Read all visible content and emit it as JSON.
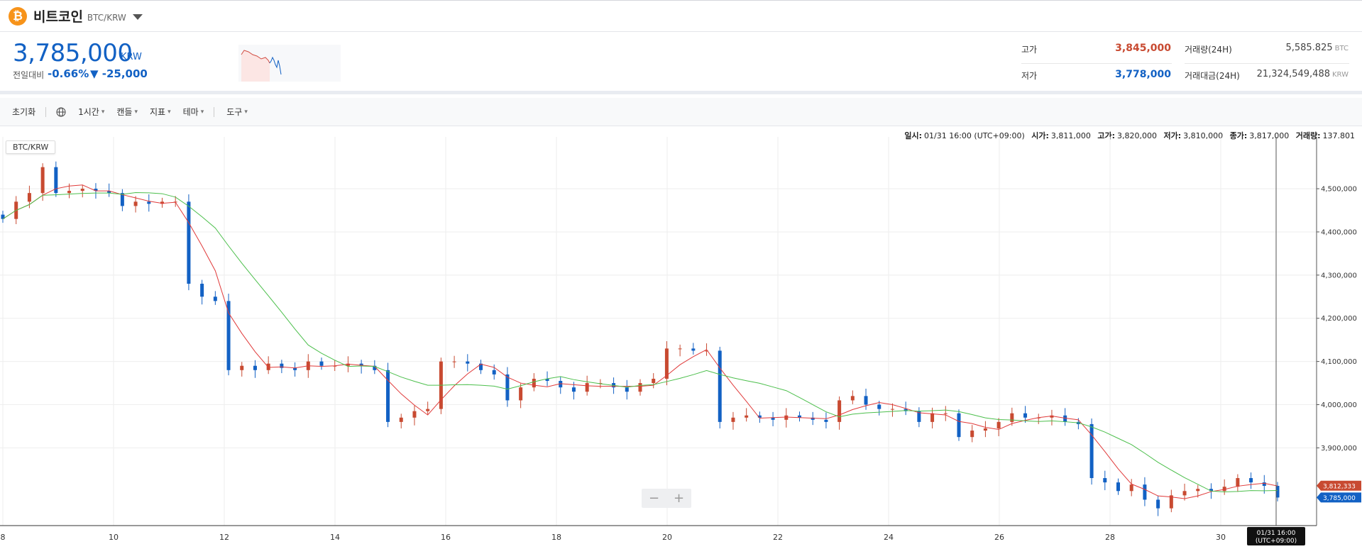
{
  "header": {
    "coin_symbol": "₿",
    "coin_name": "비트코인",
    "pair": "BTC/KRW"
  },
  "summary": {
    "price": "3,785,000",
    "price_unit": "KRW",
    "change_label": "전일대비",
    "change_pct": "-0.66%",
    "change_abs": "▼ -25,000",
    "high_label": "고가",
    "high_value": "3,845,000",
    "low_label": "저가",
    "low_value": "3,778,000",
    "volume_label": "거래량(24H)",
    "volume_value": "5,585.825",
    "volume_unit": "BTC",
    "turnover_label": "거래대금(24H)",
    "turnover_value": "21,324,549,488",
    "turnover_unit": "KRW"
  },
  "toolbar": {
    "reset": "초기화",
    "interval": "1시간",
    "candle": "캔들",
    "indicator": "지표",
    "theme": "테마",
    "tools": "도구"
  },
  "info": {
    "date_label": "일시:",
    "date_value": "01/31 16:00 (UTC+09:00)",
    "open_label": "시가:",
    "open_value": "3,811,000",
    "high_label": "고가:",
    "high_value": "3,820,000",
    "low_label": "저가:",
    "low_value": "3,810,000",
    "close_label": "종가:",
    "close_value": "3,817,000",
    "vol_label": "거래량:",
    "vol_value": "137.801"
  },
  "chart_tag": "BTC/KRW",
  "zoom": {
    "minus": "−",
    "plus": "+"
  },
  "colors": {
    "up": "#c84a31",
    "down": "#1261c4",
    "ma_short": "#e03a3a",
    "ma_long": "#4cbf4c",
    "grid": "#eeeeee"
  },
  "chart_data": {
    "type": "candlestick",
    "xlabels": [
      "8",
      "10",
      "12",
      "14",
      "16",
      "18",
      "20",
      "22",
      "24",
      "26",
      "28",
      "30"
    ],
    "ylabels": [
      "4,500,000",
      "4,400,000",
      "4,300,000",
      "4,200,000",
      "4,100,000",
      "4,000,000",
      "3,900,000"
    ],
    "ylim": [
      3720000,
      4620000
    ],
    "last_price_label": "3,785,000",
    "ma_label": "3,812,333",
    "cursor_label_line1": "01/31 16:00",
    "cursor_label_line2": "(UTC+09:00)",
    "close": [
      4430000,
      4470000,
      4490000,
      4550000,
      4490000,
      4495000,
      4500000,
      4495000,
      4490000,
      4460000,
      4470000,
      4465000,
      4470000,
      4470000,
      4280000,
      4250000,
      4240000,
      4080000,
      4090000,
      4080000,
      4095000,
      4085000,
      4080000,
      4100000,
      4090000,
      4090000,
      4095000,
      4090000,
      4080000,
      3960000,
      3970000,
      3985000,
      3990000,
      4100000,
      4100000,
      4095000,
      4080000,
      4070000,
      4010000,
      4040000,
      4060000,
      4055000,
      4040000,
      4030000,
      4050000,
      4050000,
      4040000,
      4030000,
      4050000,
      4060000,
      4130000,
      4130000,
      4125000,
      4125000,
      3960000,
      3970000,
      3975000,
      3970000,
      3965000,
      3975000,
      3970000,
      3965000,
      3960000,
      4010000,
      4020000,
      4000000,
      3990000,
      3990000,
      3985000,
      3960000,
      3980000,
      3980000,
      3925000,
      3940000,
      3945000,
      3960000,
      3980000,
      3970000,
      3970000,
      3975000,
      3960000,
      3955000,
      3830000,
      3820000,
      3800000,
      3815000,
      3780000,
      3760000,
      3790000,
      3800000,
      3805000,
      3800000,
      3810000,
      3830000,
      3820000,
      3812000,
      3785000
    ]
  }
}
